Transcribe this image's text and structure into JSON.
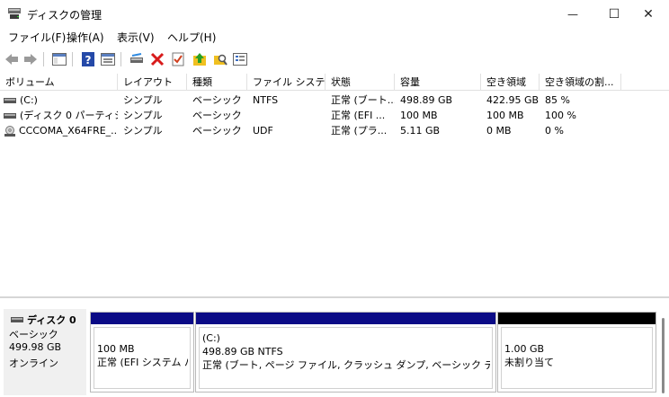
{
  "window": {
    "title": "ディスクの管理",
    "min_glyph": "—",
    "max_glyph": "☐",
    "close_glyph": "✕"
  },
  "menu": [
    "ファイル(F)",
    "操作(A)",
    "表示(V)",
    "ヘルプ(H)"
  ],
  "toolbar": {
    "icons": [
      "back-arrow-icon",
      "forward-arrow-icon",
      "console-tree-icon",
      "help-icon",
      "properties-view-icon",
      "connect-disk-icon",
      "delete-icon",
      "checklist-icon",
      "import-icon",
      "search-folder-icon",
      "properties-icon"
    ]
  },
  "table": {
    "headers": [
      "ボリューム",
      "レイアウト",
      "種類",
      "ファイル システム",
      "状態",
      "容量",
      "空き領域",
      "空き領域の割..."
    ],
    "rows": [
      {
        "volume": "(C:)",
        "layout": "シンプル",
        "type": "ベーシック",
        "fs": "NTFS",
        "status": "正常 (ブート...",
        "capacity": "498.89 GB",
        "free": "422.95 GB",
        "free_pct": "85 %"
      },
      {
        "volume": "(ディスク 0 パーティシ...",
        "layout": "シンプル",
        "type": "ベーシック",
        "fs": "",
        "status": "正常 (EFI ...",
        "capacity": "100 MB",
        "free": "100 MB",
        "free_pct": "100 %"
      },
      {
        "volume": "CCCOMA_X64FRE_...",
        "layout": "シンプル",
        "type": "ベーシック",
        "fs": "UDF",
        "status": "正常 (プラ...",
        "capacity": "5.11 GB",
        "free": "0 MB",
        "free_pct": "0 %"
      }
    ]
  },
  "disk": {
    "name": "ディスク 0",
    "kind": "ベーシック",
    "size": "499.98 GB",
    "state": "オンライン",
    "partitions": [
      {
        "line1": "100 MB",
        "line2": "正常 (EFI システム パ",
        "line3": ""
      },
      {
        "line1": "(C:)",
        "line2": "498.89 GB NTFS",
        "line3": "正常 (ブート, ページ ファイル, クラッシュ ダンプ, ベーシック データ パーティ"
      },
      {
        "line1": "1.00 GB",
        "line2": "未割り当て",
        "line3": ""
      }
    ]
  },
  "colors": {
    "primary_partition_bar": "#0b0b86",
    "unallocated_bar": "#000000"
  }
}
